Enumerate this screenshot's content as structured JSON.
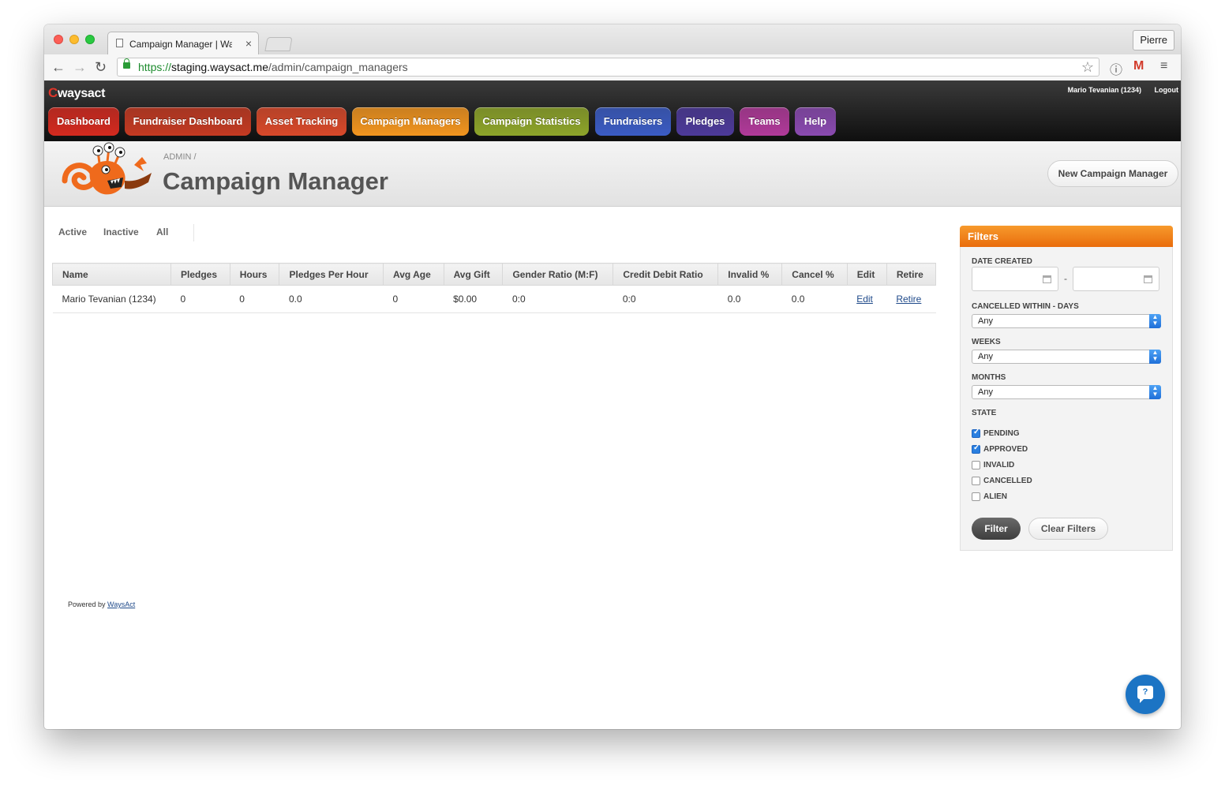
{
  "browser": {
    "tab_title": "Campaign Manager | WaysAct",
    "tab_close": "×",
    "profile": "Pierre",
    "url_scheme": "https://",
    "url_host": "staging.waysact.me",
    "url_path": "/admin/campaign_managers"
  },
  "site": {
    "logo": "waysact",
    "user": "Mario Tevanian (1234)",
    "logout": "Logout",
    "nav": [
      {
        "label": "Dashboard",
        "color": "#d42a1f"
      },
      {
        "label": "Fundraiser Dashboard",
        "color": "#c43a22"
      },
      {
        "label": "Asset Tracking",
        "color": "#d9492a"
      },
      {
        "label": "Campaign Managers",
        "color": "#f2951f"
      },
      {
        "label": "Campaign Statistics",
        "color": "#8ea52a"
      },
      {
        "label": "Fundraisers",
        "color": "#3b5cc4"
      },
      {
        "label": "Pledges",
        "color": "#4d3a9a"
      },
      {
        "label": "Teams",
        "color": "#b13a9a"
      },
      {
        "label": "Help",
        "color": "#8a4ab0"
      }
    ]
  },
  "page": {
    "breadcrumb": "ADMIN /",
    "title": "Campaign Manager",
    "new_button": "New Campaign Manager",
    "scopes": [
      "Active",
      "Inactive",
      "All"
    ]
  },
  "table": {
    "headers": [
      "Name",
      "Pledges",
      "Hours",
      "Pledges Per Hour",
      "Avg Age",
      "Avg Gift",
      "Gender Ratio (M:F)",
      "Credit Debit Ratio",
      "Invalid %",
      "Cancel %",
      "Edit",
      "Retire"
    ],
    "rows": [
      [
        "Mario Tevanian (1234)",
        "0",
        "0",
        "0.0",
        "0",
        "$0.00",
        "0:0",
        "0:0",
        "0.0",
        "0.0",
        "Edit",
        "Retire"
      ]
    ]
  },
  "filters": {
    "title": "Filters",
    "date_created_label": "DATE CREATED",
    "date_from": "",
    "date_to": "",
    "date_sep": "-",
    "days_label": "CANCELLED WITHIN - DAYS",
    "days_value": "Any",
    "weeks_label": "WEEKS",
    "weeks_value": "Any",
    "months_label": "MONTHS",
    "months_value": "Any",
    "state_label": "STATE",
    "states": [
      {
        "label": "PENDING",
        "checked": true
      },
      {
        "label": "APPROVED",
        "checked": true
      },
      {
        "label": "INVALID",
        "checked": false
      },
      {
        "label": "CANCELLED",
        "checked": false
      },
      {
        "label": "ALIEN",
        "checked": false
      }
    ],
    "filter_button": "Filter",
    "clear_button": "Clear Filters"
  },
  "footer": {
    "text": "Powered by",
    "link": "WaysAct"
  },
  "help": {
    "icon": "?"
  }
}
